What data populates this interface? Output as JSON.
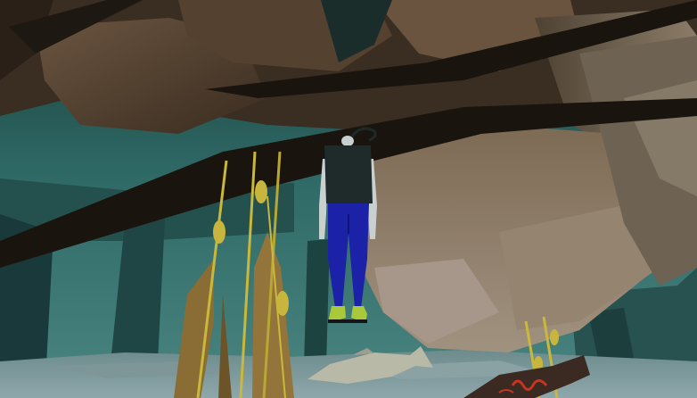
{
  "scene": {
    "environment": "underwater-cavern",
    "colors": {
      "water_deep": "#0f2e2e",
      "water_mid": "#2c6663",
      "water_light": "#4d8d88",
      "seafloor": "#7c9aa0",
      "rock_dark": "#2b2118",
      "rock_mid": "#5f4a36",
      "rock_light": "#8d7a62",
      "kelp_stalk": "#c9b83a",
      "kelp_blade": "#8a6d34",
      "diver_vest": "#1f2a2a",
      "diver_pants": "#1b22a8",
      "diver_skin": "#c8d0d0",
      "diver_fins": "#a7c93a",
      "fish_pale": "#b8b8a6",
      "fish_dark": "#3a2a22",
      "fish_markings": "#c8341e"
    }
  }
}
